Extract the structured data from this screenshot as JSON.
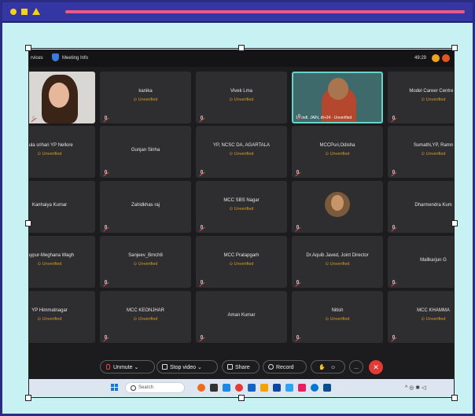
{
  "meeting": {
    "left_label": "rvices",
    "title": "Meeting Info",
    "time": "49:29"
  },
  "tiles": [
    {
      "name": "",
      "status": "",
      "kind": "video-woman"
    },
    {
      "name": "kanika",
      "status": "Unverified"
    },
    {
      "name": "Vivek Lma",
      "status": "Unverified"
    },
    {
      "name": "1 - Indl. JAIN, dt+24",
      "status": "Unverified",
      "kind": "video-man"
    },
    {
      "name": "Model Career Centre T",
      "status": "Unverified"
    },
    {
      "name": "dula srihari YP Nellore",
      "status": "Unverified"
    },
    {
      "name": "Gunjan Sinha",
      "status": ""
    },
    {
      "name": "YP, NCSC DA, AGARTALA",
      "status": "Unverified"
    },
    {
      "name": "MCCPuri,Odisha",
      "status": "Unverified"
    },
    {
      "name": "Sumathi,YP, Ramn",
      "status": "Unverified"
    },
    {
      "name": "Kanhaiya Kumar",
      "status": ""
    },
    {
      "name": "Zahidkhas raj",
      "status": ""
    },
    {
      "name": "MCC SBS Nagar",
      "status": "Unverified"
    },
    {
      "name": "",
      "status": "",
      "kind": "avatar"
    },
    {
      "name": "Dharmendra Kum",
      "status": ""
    },
    {
      "name": "Jaypur-Meghana Wagh",
      "status": "Unverified"
    },
    {
      "name": "Sanjeev_Bmch8",
      "status": "Unverified"
    },
    {
      "name": "MCC Pratapgarh",
      "status": "Unverified"
    },
    {
      "name": "Dr.Aquib Javed, Joint Director",
      "status": "Unverified"
    },
    {
      "name": "Mallkarjun G",
      "status": ""
    },
    {
      "name": "YP Himmatnagar",
      "status": "Unverified"
    },
    {
      "name": "MCC KEONJHAR",
      "status": "Unverified"
    },
    {
      "name": "Aman Kumar",
      "status": ""
    },
    {
      "name": "Nitish",
      "status": "Unverified"
    },
    {
      "name": "MCC KHAMMA",
      "status": "Unverified"
    }
  ],
  "controls": {
    "unmute": "Unmute",
    "stop_video": "Stop video",
    "share": "Share",
    "record": "Record",
    "more": "...",
    "end": "✕"
  },
  "taskbar": {
    "search_placeholder": "Search",
    "tray": "^ ◎ ✱ ◁"
  },
  "colors": {
    "unverified": "#d79a2a",
    "end_call": "#e53935",
    "frame_bg": "#c8f1f4",
    "frame_bar": "#3437a3",
    "accent_line": "#e95a86"
  }
}
